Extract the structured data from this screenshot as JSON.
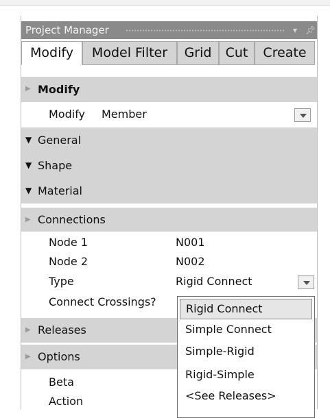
{
  "panel": {
    "title": "Project Manager"
  },
  "tabs": [
    {
      "label": "Modify"
    },
    {
      "label": "Model Filter"
    },
    {
      "label": "Grid"
    },
    {
      "label": "Cut"
    },
    {
      "label": "Create"
    }
  ],
  "sections": {
    "modify": {
      "label": "Modify",
      "field_label": "Modify",
      "field_value": "Member"
    },
    "general": {
      "label": "General"
    },
    "shape": {
      "label": "Shape"
    },
    "material": {
      "label": "Material"
    },
    "connections": {
      "label": "Connections",
      "node1_label": "Node 1",
      "node1_value": "N001",
      "node2_label": "Node 2",
      "node2_value": "N002",
      "type_label": "Type",
      "type_value": "Rigid Connect",
      "crossings_label": "Connect Crossings?"
    },
    "releases": {
      "label": "Releases"
    },
    "options": {
      "label": "Options",
      "beta_label": "Beta",
      "action_label": "Action"
    }
  },
  "type_dropdown": {
    "options": [
      "Rigid Connect",
      "Simple Connect",
      "Simple-Rigid",
      "Rigid-Simple",
      "<See Releases>"
    ],
    "selected": "Rigid Connect"
  },
  "icons": {
    "collapsed": "triangle-right-icon",
    "expanded": "triangle-down-icon",
    "dropdown": "chevron-down-icon",
    "pin": "pin-icon"
  },
  "colors": {
    "title_bar": "#8a8a8a",
    "section_bg": "#d4d4d4",
    "tab_inactive": "#d4d4d4",
    "selection": "#e6e6e6"
  }
}
